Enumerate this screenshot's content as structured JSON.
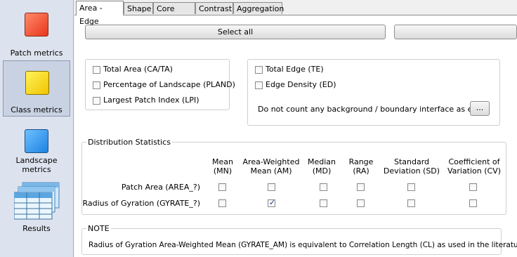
{
  "sidebar": {
    "items": [
      {
        "label": "Patch metrics",
        "icon": "patch-metrics-icon"
      },
      {
        "label": "Class metrics",
        "icon": "class-metrics-icon"
      },
      {
        "label": "Landscape metrics",
        "icon": "landscape-metrics-icon"
      },
      {
        "label": "Results",
        "icon": "results-icon"
      }
    ]
  },
  "tabs": [
    "Area - Edge",
    "Shape",
    "Core area",
    "Contrast",
    "Aggregation"
  ],
  "buttons": {
    "select_all": "Select all",
    "ellipsis": "..."
  },
  "area_group": {
    "items": [
      {
        "label": "Total Area  (CA/TA)",
        "checked": false
      },
      {
        "label": "Percentage of Landscape  (PLAND)",
        "checked": false
      },
      {
        "label": "Largest Patch Index  (LPI)",
        "checked": false
      }
    ]
  },
  "edge_group": {
    "items": [
      {
        "label": "Total Edge  (TE)",
        "checked": false
      },
      {
        "label": "Edge Density  (ED)",
        "checked": false
      }
    ],
    "note": "Do not count any background / boundary interface as edge."
  },
  "distribution": {
    "title": "Distribution Statistics",
    "columns": [
      "Mean\n(MN)",
      "Area-Weighted\nMean (AM)",
      "Median\n(MD)",
      "Range\n(RA)",
      "Standard\nDeviation (SD)",
      "Coefficient of\nVariation (CV)"
    ],
    "rows": [
      {
        "label": "Patch Area (AREA_?)",
        "checked": [
          false,
          false,
          false,
          false,
          false,
          false
        ]
      },
      {
        "label": "Radius of Gyration (GYRATE_?)",
        "checked": [
          false,
          true,
          false,
          false,
          false,
          false
        ]
      }
    ]
  },
  "note_box": {
    "title": "NOTE",
    "text": "Radius of Gyration Area-Weighted Mean (GYRATE_AM) is equivalent to Correlation Length (CL) as used in the literature."
  },
  "colors": {
    "sidebar_bg": "#dde3ee",
    "selected_bg": "#c9d2e3",
    "check": "#1a3f8c"
  }
}
